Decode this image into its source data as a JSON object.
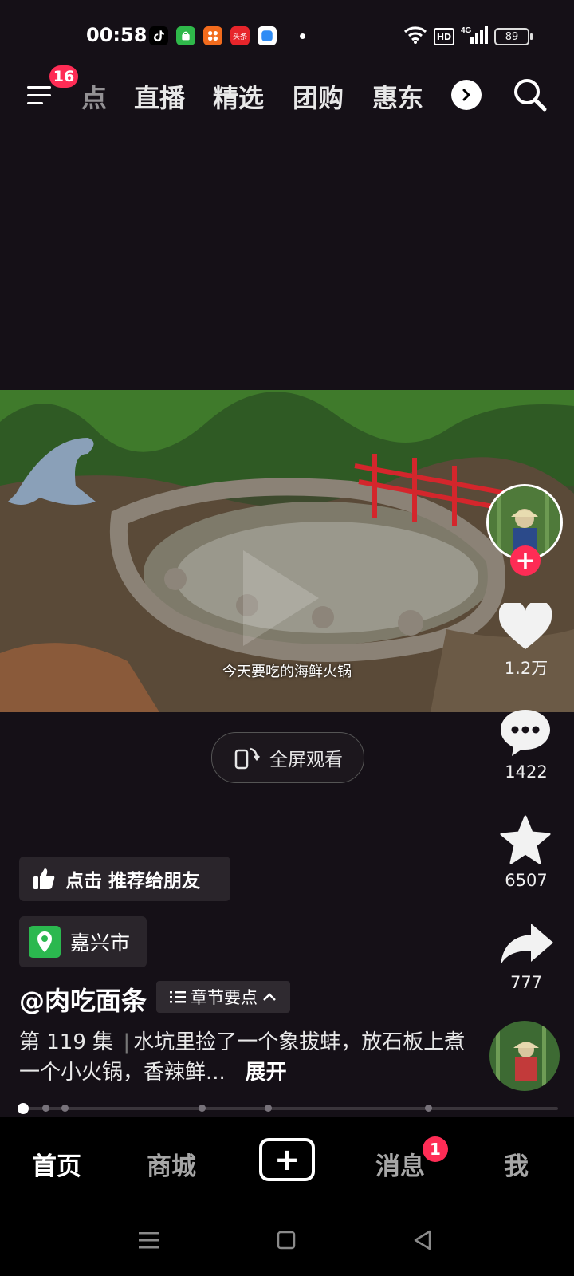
{
  "status_bar": {
    "time": "00:58",
    "notification_icons": [
      "tiktok-icon",
      "android-store-icon",
      "app-grid-icon",
      "toutiao-icon",
      "browser-icon"
    ],
    "toutiao_label": "头条",
    "network": "4G",
    "hd_label": "HD",
    "battery": "89"
  },
  "top_nav": {
    "menu_badge": "16",
    "tabs": [
      "点",
      "直播",
      "精选",
      "团购",
      "惠东"
    ]
  },
  "video": {
    "subtitle": "今天要吃的海鲜火锅",
    "fullscreen_label": "全屏观看"
  },
  "right_rail": {
    "likes": "1.2万",
    "comments": "1422",
    "favorites": "6507",
    "shares": "777"
  },
  "info": {
    "recommend_label": "点击 推荐给朋友",
    "location": "嘉兴市",
    "author": "@肉吃面条",
    "chapter_label": "章节要点",
    "episode": "第 119 集",
    "description": "水坑里捡了一个象拔蚌，放石板上煮一个小火锅，香辣鲜...",
    "expand": "展开"
  },
  "bottom_nav": {
    "home": "首页",
    "shop": "商城",
    "messages": "消息",
    "messages_badge": "1",
    "me": "我"
  },
  "colors": {
    "background": "#151017",
    "accent": "#fe2c55",
    "chip": "#2a252b",
    "location_green": "#2bb84f"
  }
}
